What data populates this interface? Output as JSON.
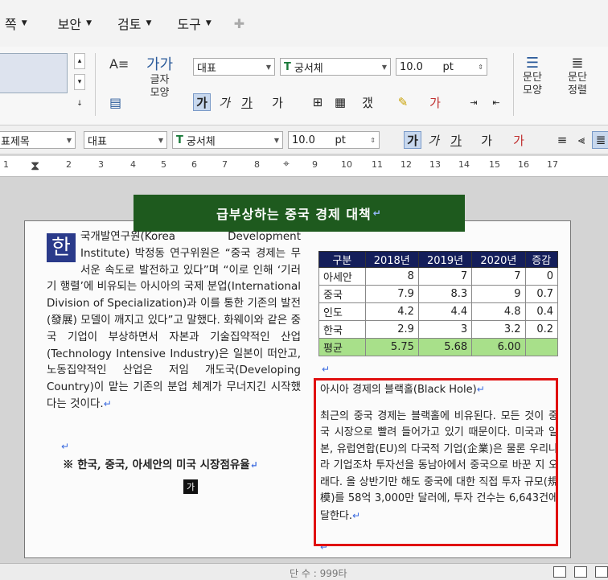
{
  "menubar": {
    "items": [
      "쪽",
      "보안",
      "검토",
      "도구"
    ]
  },
  "ribbon": {
    "char_shape_label": "글자\n모양",
    "para_shape_label": "문단\n모양",
    "para_align_label": "문단\n정렬",
    "style_combo": "대표",
    "font_combo": "궁서체",
    "size_value": "10.0",
    "size_unit": "pt",
    "gaga_icon": "가가"
  },
  "formatbar": {
    "style_name": "표제목",
    "lang_combo": "대표",
    "font_combo": "궁서체",
    "size_value": "10.0",
    "size_unit": "pt"
  },
  "ruler": {
    "numbers": [
      "1",
      "2",
      "3",
      "4",
      "5",
      "6",
      "7",
      "8",
      "9",
      "10",
      "11",
      "12",
      "13",
      "14",
      "15",
      "16",
      "17"
    ]
  },
  "document": {
    "title": "급부상하는 중국 경제 대책",
    "dropcap": "한",
    "left_paragraph": "국개발연구원(Korea Development Institute) 박정동 연구위원은 “중국 경제는 무서운 속도로 발전하고 있다”며 “이로 인해 ‘기러기 행렬’에 비유되는 아시아의 국제 분업(International Division of Specialization)과 이를 통한 기존의 발전(發展) 모델이 깨지고 있다”고 말했다. 화웨이와 같은 중국 기업이 부상하면서 자본과 기술집약적인 산업(Technology Intensive Industry)은 일본이 떠안고, 노동집약적인 산업은 저임 개도국(Developing Country)이 맡는 기존의 분업 체계가 무너지긴 시작했다는 것이다.",
    "bullet": "※ 한국, 중국, 아세안의 미국 시장점유율",
    "ga_mark": "가",
    "table": {
      "headers": [
        "구분",
        "2018년",
        "2019년",
        "2020년",
        "증감"
      ],
      "rows": [
        [
          "아세안",
          "8",
          "7",
          "7",
          "0"
        ],
        [
          "중국",
          "7.9",
          "8.3",
          "9",
          "0.7"
        ],
        [
          "인도",
          "4.2",
          "4.4",
          "4.8",
          "0.4"
        ],
        [
          "한국",
          "2.9",
          "3",
          "3.2",
          "0.2"
        ]
      ],
      "avg": [
        "평균",
        "5.75",
        "5.68",
        "6.00",
        ""
      ]
    },
    "right_heading": "아시아 경제의 블랙홀(Black Hole)",
    "right_paragraph": "최근의 중국 경제는 블랙홀에 비유된다. 모든 것이 중국 시장으로 빨려 들어가고 있기 때문이다. 미국과 일본, 유럽연합(EU)의 다국적 기업(企業)은 물론 우리나라 기업조차 투자선을 동남아에서 중국으로 바꾼 지 오래다. 올 상반기만 해도 중국에 대한 직접 투자 규모(規模)를 58억 3,000만 달러에, 투자 건수는 6,643건에 달한다.",
    "return_mark": "↵"
  },
  "statusbar": {
    "text": "단 수 : 999타"
  },
  "colors": {
    "title_bg": "#1e5a1e",
    "table_header_bg": "#141e5a",
    "avg_row_bg": "#a8e08a",
    "highlight_border": "#e01010",
    "dropcap_bg": "#2a3a8a"
  }
}
